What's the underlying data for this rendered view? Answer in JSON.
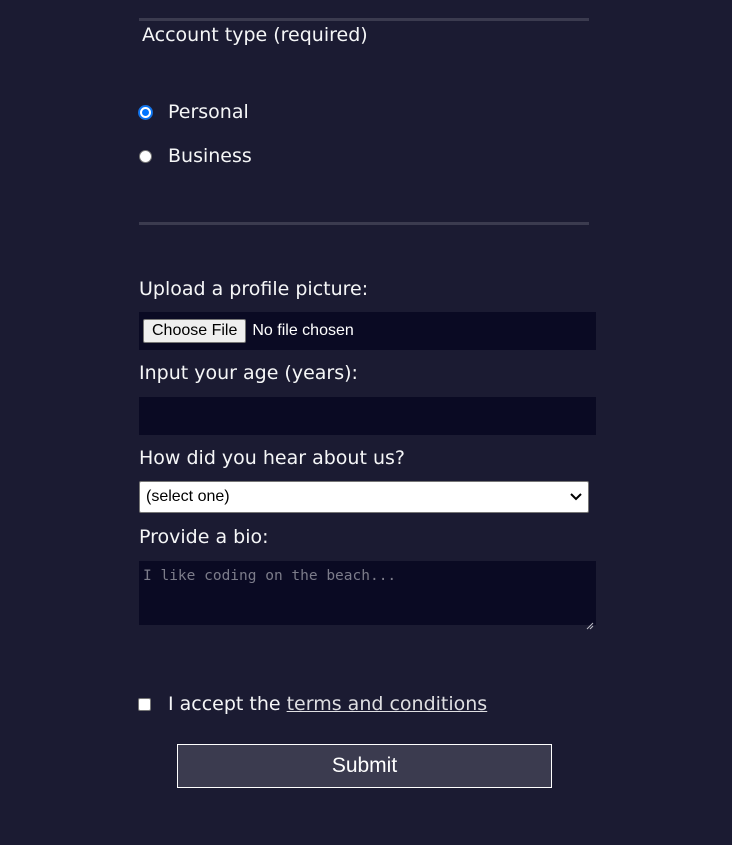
{
  "account_type": {
    "legend": "Account type (required)",
    "options": [
      {
        "label": "Personal",
        "checked": true
      },
      {
        "label": "Business",
        "checked": false
      }
    ]
  },
  "profile_picture": {
    "label": "Upload a profile picture:",
    "button_label": "Choose File",
    "status": "No file chosen"
  },
  "age": {
    "label": "Input your age (years):",
    "value": ""
  },
  "referrer": {
    "label": "How did you hear about us?",
    "selected": "(select one)"
  },
  "bio": {
    "label": "Provide a bio:",
    "placeholder": "I like coding on the beach..."
  },
  "terms": {
    "prefix": "I accept the",
    "link_text": "terms and conditions",
    "checked": false
  },
  "submit": {
    "label": "Submit"
  },
  "colors": {
    "background": "#1b1b32",
    "input_background": "#0a0a23",
    "button_background": "#3b3b4f",
    "radio_accent": "#0075ff"
  },
  "icons": {
    "select_arrow": "chevron-down-icon",
    "resize": "resize-grip-icon"
  }
}
